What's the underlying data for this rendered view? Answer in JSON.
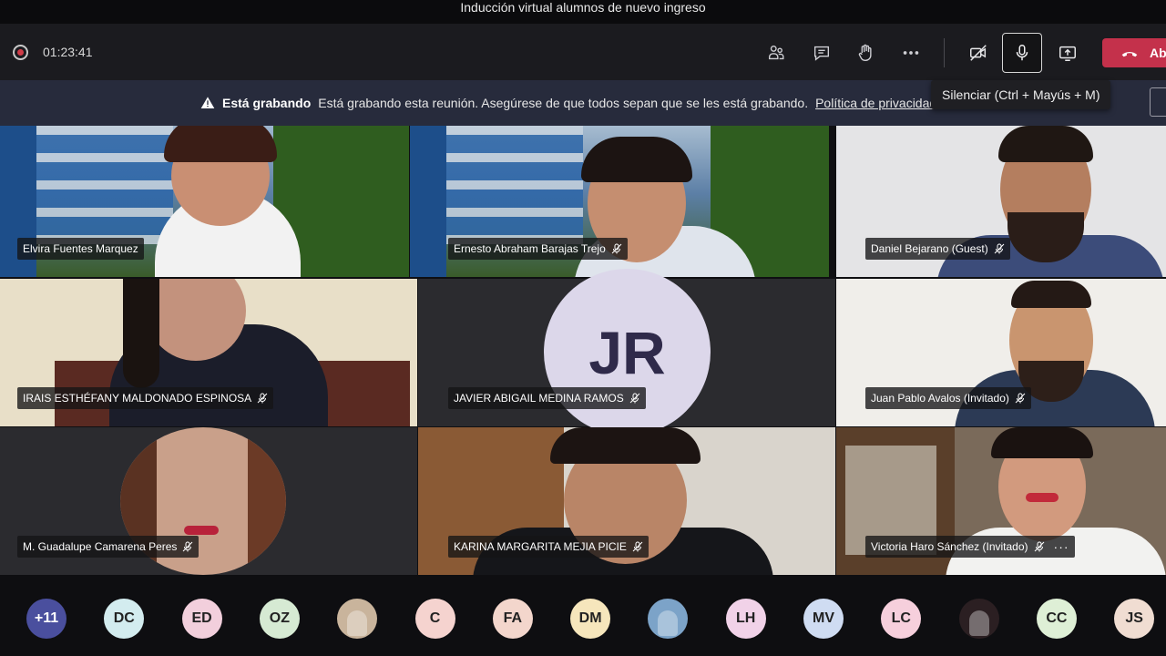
{
  "window": {
    "title": "Inducción virtual alumnos de nuevo ingreso"
  },
  "toolbar": {
    "timer": "01:23:41",
    "hangup_label": "Ab",
    "icons": [
      "recording-icon",
      "participants-icon",
      "chat-icon",
      "raise-hand-icon",
      "more-icon",
      "camera-off-icon",
      "microphone-icon",
      "share-screen-icon",
      "hangup-icon"
    ]
  },
  "banner": {
    "bold": "Está grabando",
    "text": "Está grabando esta reunión. Asegúrese de que todos sepan que se les está grabando.",
    "link": "Política de privacidad"
  },
  "tooltip": "Silenciar (Ctrl + Mayús + M)",
  "participants": [
    {
      "name": "Elvira Fuentes Marquez",
      "muted": false
    },
    {
      "name": "Ernesto Abraham Barajas Trejo",
      "muted": true
    },
    {
      "name": "Daniel Bejarano (Guest)",
      "muted": true
    },
    {
      "name": "IRAIS ESTHÉFANY MALDONADO ESPINOSA",
      "muted": true
    },
    {
      "name": "JAVIER ABIGAIL MEDINA RAMOS",
      "muted": true,
      "initials": "JR"
    },
    {
      "name": "Juan Pablo Avalos (Invitado)",
      "muted": true
    },
    {
      "name": "M. Guadalupe Camarena Peres",
      "muted": true
    },
    {
      "name": "KARINA MARGARITA MEJIA PICIE",
      "muted": true
    },
    {
      "name": "Victoria Haro Sánchez (Invitado)",
      "muted": true,
      "more": "···"
    }
  ],
  "roster": [
    {
      "label": "+11",
      "color": "#4a4f9e",
      "text_color": "#ffffff"
    },
    {
      "label": "DC",
      "color": "#d3ecef"
    },
    {
      "label": "ED",
      "color": "#f2cfdc"
    },
    {
      "label": "OZ",
      "color": "#d6ead3"
    },
    {
      "label": "",
      "color": "#c9b49c",
      "photo": true
    },
    {
      "label": "C",
      "color": "#f5d3cf"
    },
    {
      "label": "FA",
      "color": "#f3d6cc"
    },
    {
      "label": "DM",
      "color": "#f6e6bc"
    },
    {
      "label": "",
      "color": "#7ca3c8",
      "photo": true
    },
    {
      "label": "LH",
      "color": "#f1d2e8"
    },
    {
      "label": "MV",
      "color": "#cfdcf2"
    },
    {
      "label": "LC",
      "color": "#f6cfdc"
    },
    {
      "label": "",
      "color": "#2b1f22",
      "photo": true
    },
    {
      "label": "CC",
      "color": "#deefd6"
    },
    {
      "label": "JS",
      "color": "#f0ddd2"
    }
  ]
}
